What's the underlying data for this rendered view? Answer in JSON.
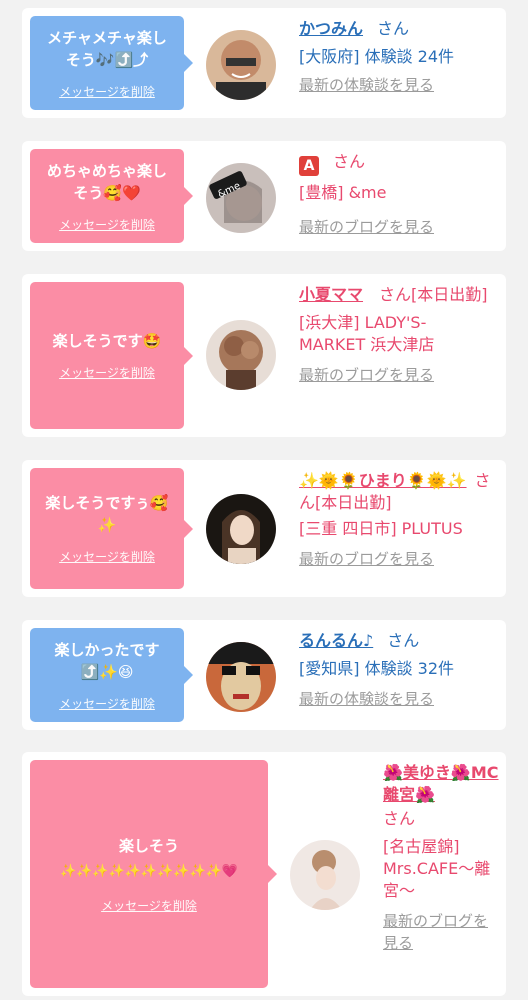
{
  "messages": [
    {
      "text": "メチャメチャ楽しそう🎶⤴️⤴",
      "delete_label": "メッセージを削除",
      "user_name": "かつみん",
      "honorific": "さん",
      "sub": "[大阪府] 体験談 24件",
      "more_label": "最新の体験談を見る"
    },
    {
      "text": "めちゃめちゃ楽しそう🥰❤️",
      "delete_label": "メッセージを削除",
      "user_name": "A",
      "honorific": "さん",
      "sub": "[豊橋] &me",
      "more_label": "最新のブログを見る"
    },
    {
      "text": "楽しそうです🤩",
      "delete_label": "メッセージを削除",
      "user_name": "小夏ママ",
      "honorific": "さん[本日出勤]",
      "sub": "[浜大津] LADY'S-MARKET 浜大津店",
      "more_label": "最新のブログを見る"
    },
    {
      "text": "楽しそうですぅ🥰✨",
      "delete_label": "メッセージを削除",
      "user_name": "✨🌞🌻ひまり🌻🌞✨",
      "honorific": "さん[本日出勤]",
      "sub": "[三重 四日市] PLUTUS",
      "more_label": "最新のブログを見る"
    },
    {
      "text": "楽しかったです⤴️✨😆",
      "delete_label": "メッセージを削除",
      "user_name": "るんるん♪",
      "honorific": "さん",
      "sub": "[愛知県] 体験談 32件",
      "more_label": "最新の体験談を見る"
    },
    {
      "text_line1": "楽しそう",
      "text_line2": "✨✨✨✨✨✨✨✨✨✨💗",
      "delete_label": "メッセージを削除",
      "user_name": "🌺美ゆき🌺MC離宮🌺",
      "honorific": "さん",
      "sub": "[名古屋錦] Mrs.CAFE〜離宮〜",
      "more_label": "最新のブログを見る"
    }
  ],
  "avatar_labels": {
    "me_logo": "&me"
  },
  "colors": {
    "blue_bubble": "#7eb3ef",
    "pink_bubble": "#fb8da5",
    "blue_text": "#2a6fb8",
    "pink_text": "#e8496e",
    "muted_link": "#9b9b9b"
  }
}
